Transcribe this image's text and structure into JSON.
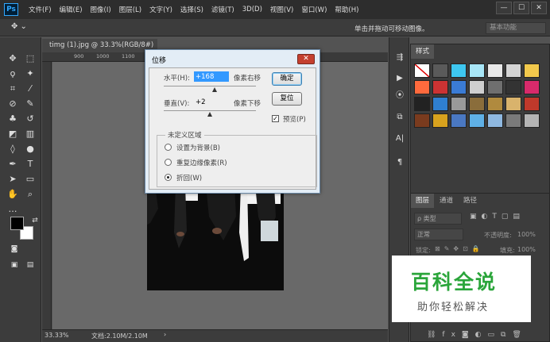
{
  "app": {
    "logo": "Ps",
    "menu": [
      "文件(F)",
      "编辑(E)",
      "图像(I)",
      "图层(L)",
      "文字(Y)",
      "选择(S)",
      "滤镜(T)",
      "3D(D)",
      "视图(V)",
      "窗口(W)",
      "帮助(H)"
    ],
    "window_controls": [
      "—",
      "☐",
      "✕"
    ]
  },
  "options_bar": {
    "tool_icon": "move-icon",
    "tool_glyph": "✥ ⌄",
    "hint": "单击并拖动可移动图像。",
    "workspace": "基本功能"
  },
  "document": {
    "tab_label": "timg (1).jpg @ 33.3%(RGB/8#) *",
    "tab_close": "×",
    "ruler_marks": [
      "900",
      "1000",
      "1100",
      "1200",
      "1300",
      "1400",
      "1500"
    ],
    "zoom": "33.33%",
    "doc_size": "文档:2.10M/2.10M"
  },
  "dialog": {
    "title": "位移",
    "close": "✕",
    "horizontal_label": "水平(H):",
    "horizontal_value": "+168",
    "horizontal_unit": "像素右移",
    "vertical_label": "垂直(V):",
    "vertical_value": "+2",
    "vertical_unit": "像素下移",
    "ok": "确定",
    "reset": "复位",
    "preview_label": "预览(P)",
    "preview_checked": true,
    "undefined_area_title": "未定义区域",
    "options": [
      "设置为背景(B)",
      "重复边缘像素(R)",
      "折回(W)"
    ],
    "selected_option": "折回(W)"
  },
  "styles_panel": {
    "tab": "样式",
    "swatch_colors": [
      "#ffffff",
      "#5a5a5a",
      "#3ec7f0",
      "#a8e6f7",
      "#e8e8e8",
      "#d4d4d4",
      "#f2c94c",
      "#ff6a3d",
      "#cc3333",
      "#3a7bd5",
      "#cfcfcf",
      "#6f6f6f",
      "#333333",
      "#d82a6b",
      "#222222",
      "#2f7fd0",
      "#9a9a9a",
      "#8a6d3b",
      "#b08a3e",
      "#d9b36c",
      "#c0392b",
      "#7a3b1e",
      "#d8a21e",
      "#4a78c2",
      "#5fb0e6",
      "#8fb8e0",
      "#7a7a7a",
      "#b4b4b4"
    ]
  },
  "layers_panel": {
    "tabs": [
      "图层",
      "通道",
      "路径"
    ],
    "filter": "ρ 类型",
    "blend": "正常",
    "opacity_label": "不透明度:",
    "opacity_value": "100%",
    "lock_label": "锁定:",
    "fill_label": "填充:",
    "fill_value": "100%"
  },
  "watermark": {
    "title": "百科全说",
    "subtitle": "助你轻松解决"
  }
}
